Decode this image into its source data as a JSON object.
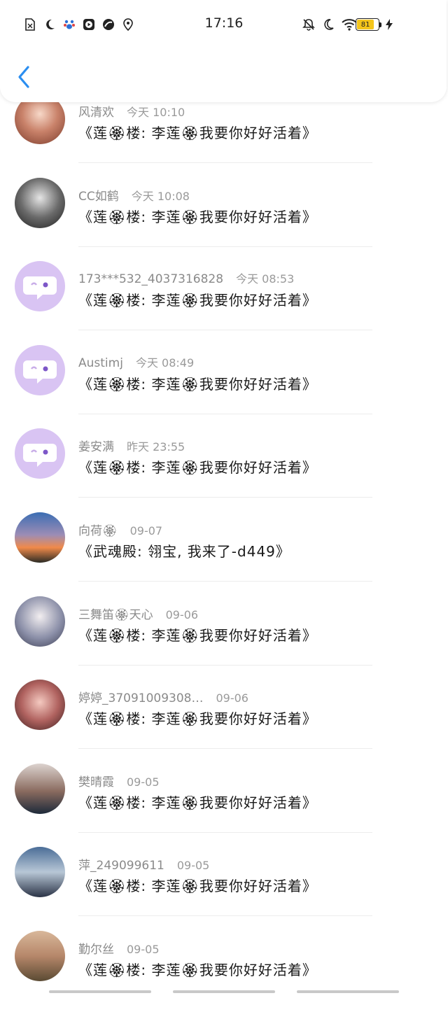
{
  "status_bar": {
    "time": "17:16",
    "battery": "81",
    "left_icons": [
      "no-sim-icon",
      "moon-icon",
      "app-paw-icon",
      "play-icon",
      "swirl-icon",
      "location-pin-icon"
    ],
    "right_icons": [
      "mute-bell-icon",
      "moon-icon",
      "wifi-icon",
      "battery-icon",
      "charging-icon"
    ]
  },
  "header": {
    "back_icon": "chevron-left-icon"
  },
  "avatar_colors": {
    "default_bg": "#d9c4f3",
    "default_icon": "#ffffff"
  },
  "comments": [
    {
      "name": "风清欢",
      "time": "今天 10:10",
      "message": "《莲🏵楼: 李莲🏵我要你好好活着》",
      "avatar": "photo"
    },
    {
      "name": "CC如鹤",
      "time": "今天 10:08",
      "message": "《莲🏵楼: 李莲🏵我要你好好活着》",
      "avatar": "photo"
    },
    {
      "name": "173***532_4037316828",
      "time": "今天 08:53",
      "message": "《莲🏵楼: 李莲🏵我要你好好活着》",
      "avatar": "default"
    },
    {
      "name": "Austimj",
      "time": "今天 08:49",
      "message": "《莲🏵楼: 李莲🏵我要你好好活着》",
      "avatar": "default"
    },
    {
      "name": "姜安满",
      "time": "昨天 23:55",
      "message": "《莲🏵楼: 李莲🏵我要你好好活着》",
      "avatar": "default"
    },
    {
      "name": "向荷🏵",
      "time": "09-07",
      "message": "《武魂殿: 翎宝, 我来了-d449》",
      "avatar": "photo"
    },
    {
      "name": "三舞笛🏵天心",
      "time": "09-06",
      "message": "《莲🏵楼: 李莲🏵我要你好好活着》",
      "avatar": "photo"
    },
    {
      "name": "婷婷_37091009308…",
      "time": "09-06",
      "message": "《莲🏵楼: 李莲🏵我要你好好活着》",
      "avatar": "photo"
    },
    {
      "name": "樊晴霞",
      "time": "09-05",
      "message": "《莲🏵楼: 李莲🏵我要你好好活着》",
      "avatar": "photo"
    },
    {
      "name": "萍_249099611",
      "time": "09-05",
      "message": "《莲🏵楼: 李莲🏵我要你好好活着》",
      "avatar": "photo"
    },
    {
      "name": "勤尔丝",
      "time": "09-05",
      "message": "《莲🏵楼: 李莲🏵我要你好好活着》",
      "avatar": "photo"
    }
  ]
}
